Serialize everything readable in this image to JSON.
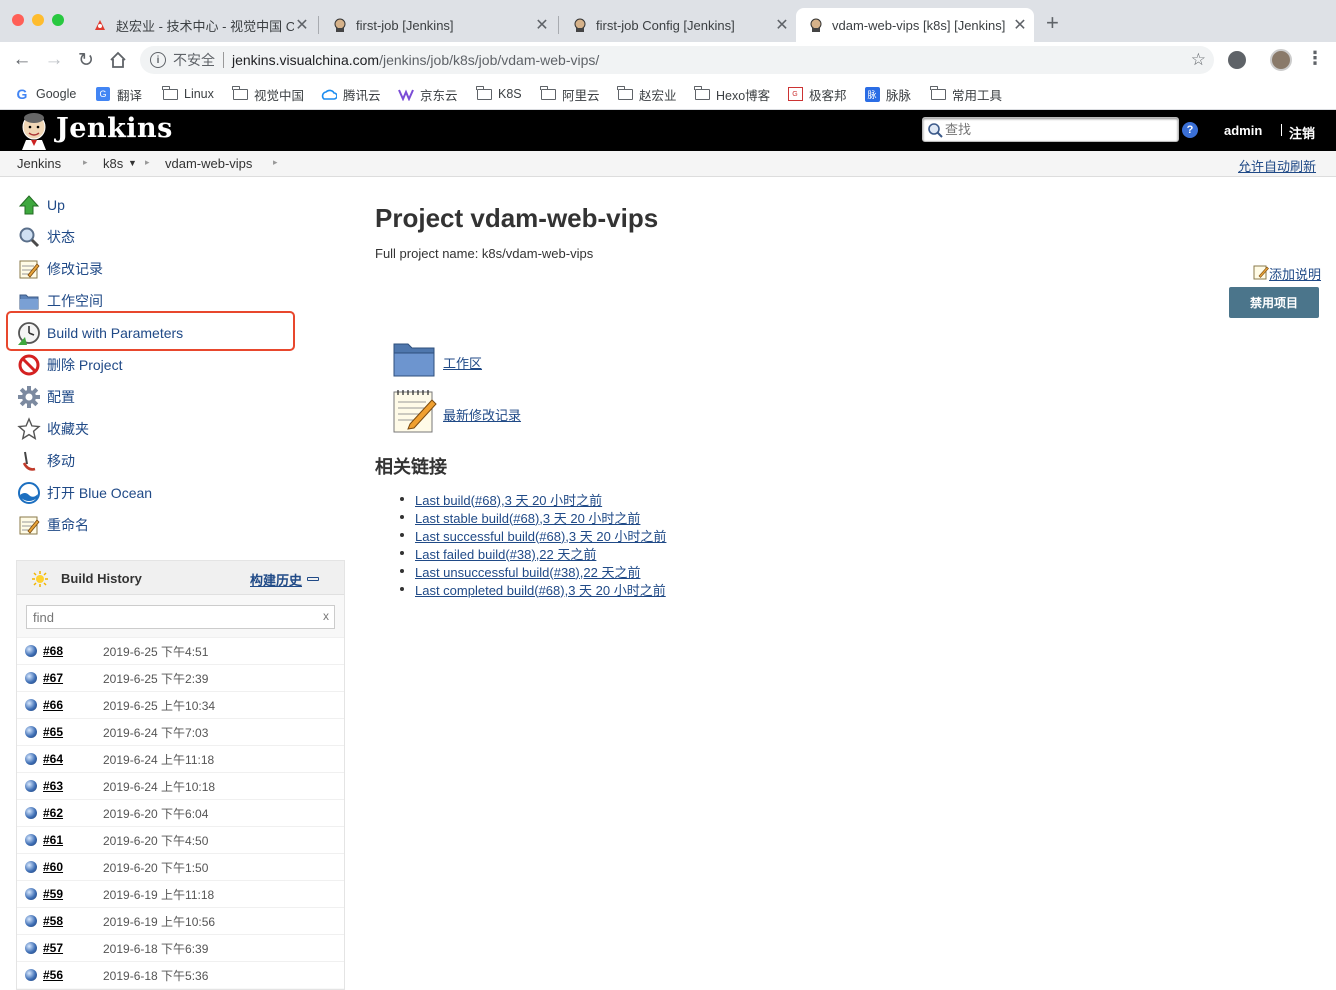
{
  "browser": {
    "tabs": [
      {
        "title": "赵宏业 - 技术中心 - 视觉中国 Co"
      },
      {
        "title": "first-job [Jenkins]"
      },
      {
        "title": "first-job Config [Jenkins]"
      },
      {
        "title": "vdam-web-vips [k8s] [Jenkins]"
      }
    ],
    "new_tab": "+",
    "security_label": "不安全",
    "url_host": "jenkins.visualchina.com",
    "url_path": "/jenkins/job/k8s/job/vdam-web-vips/",
    "bookmarks": [
      "Google",
      "翻译",
      "Linux",
      "视觉中国",
      "腾讯云",
      "京东云",
      "K8S",
      "阿里云",
      "赵宏业",
      "Hexo博客",
      "极客邦",
      "脉脉",
      "常用工具"
    ]
  },
  "jenkins": {
    "logo_text": "Jenkins",
    "search_placeholder": "查找",
    "help": "?",
    "user": "admin",
    "logout": "注销"
  },
  "breadcrumbs": [
    "Jenkins",
    "k8s",
    "vdam-web-vips"
  ],
  "auto_refresh": "允许自动刷新",
  "sidebar": {
    "items": [
      {
        "label": "Up",
        "icon": "up-arrow-icon"
      },
      {
        "label": "状态",
        "icon": "magnifier-icon"
      },
      {
        "label": "修改记录",
        "icon": "notepad-icon"
      },
      {
        "label": "工作空间",
        "icon": "folder-icon"
      },
      {
        "label": "Build with Parameters",
        "icon": "clock-icon"
      },
      {
        "label": "删除 Project",
        "icon": "no-entry-icon"
      },
      {
        "label": "配置",
        "icon": "gear-icon"
      },
      {
        "label": "收藏夹",
        "icon": "star-icon"
      },
      {
        "label": "移动",
        "icon": "move-icon"
      },
      {
        "label": "打开 Blue Ocean",
        "icon": "blue-ocean-icon"
      },
      {
        "label": "重命名",
        "icon": "notepad-icon"
      }
    ]
  },
  "build_history": {
    "title": "Build History",
    "trend_link": "构建历史",
    "filter_placeholder": "find",
    "clear": "x",
    "builds": [
      {
        "num": "#68",
        "date": "2019-6-25 下午4:51"
      },
      {
        "num": "#67",
        "date": "2019-6-25 下午2:39"
      },
      {
        "num": "#66",
        "date": "2019-6-25 上午10:34"
      },
      {
        "num": "#65",
        "date": "2019-6-24 下午7:03"
      },
      {
        "num": "#64",
        "date": "2019-6-24 上午11:18"
      },
      {
        "num": "#63",
        "date": "2019-6-24 上午10:18"
      },
      {
        "num": "#62",
        "date": "2019-6-20 下午6:04"
      },
      {
        "num": "#61",
        "date": "2019-6-20 下午4:50"
      },
      {
        "num": "#60",
        "date": "2019-6-20 下午1:50"
      },
      {
        "num": "#59",
        "date": "2019-6-19 上午11:18"
      },
      {
        "num": "#58",
        "date": "2019-6-19 上午10:56"
      },
      {
        "num": "#57",
        "date": "2019-6-18 下午6:39"
      },
      {
        "num": "#56",
        "date": "2019-6-18 下午5:36"
      }
    ]
  },
  "main": {
    "title": "Project vdam-web-vips",
    "full_name": "Full project name: k8s/vdam-web-vips",
    "add_description": "添加说明",
    "disable_button": "禁用项目",
    "workspace_link": "工作区",
    "changes_link": "最新修改记录",
    "related_heading": "相关链接",
    "related": [
      "Last build(#68),3 天 20 小时之前",
      "Last stable build(#68),3 天 20 小时之前",
      "Last successful build(#68),3 天 20 小时之前",
      "Last failed build(#38),22 天之前",
      "Last unsuccessful build(#38),22 天之前",
      "Last completed build(#68),3 天 20 小时之前"
    ]
  },
  "colors": {
    "header": "#000000",
    "link": "#204a87",
    "highlight": "#e8472d",
    "disable_btn": "#4b758b"
  }
}
